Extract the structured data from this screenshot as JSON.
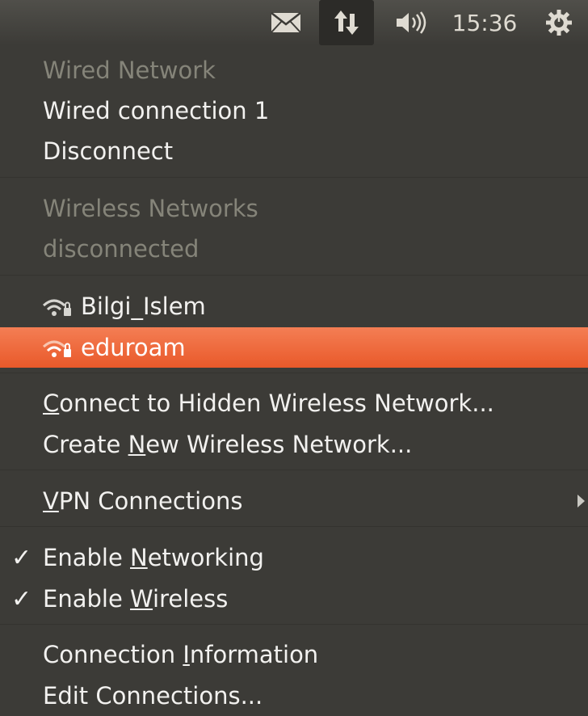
{
  "top_panel": {
    "clock": "15:36",
    "tray_icons": [
      "mail-icon",
      "network-arrows-icon",
      "volume-icon",
      "power-gear-icon"
    ]
  },
  "menu": {
    "wired": {
      "header": "Wired Network",
      "connection": "Wired connection 1",
      "disconnect": "Disconnect"
    },
    "wireless": {
      "header": "Wireless Networks",
      "status": "disconnected",
      "networks": [
        {
          "name": "Bilgi_Islem",
          "highlighted": false
        },
        {
          "name": "eduroam",
          "highlighted": true
        }
      ]
    },
    "hidden_network": {
      "prefix": "",
      "mnemonic": "C",
      "suffix": "onnect to Hidden Wireless Network..."
    },
    "new_network": {
      "prefix": "Create ",
      "mnemonic": "N",
      "suffix": "ew Wireless Network..."
    },
    "vpn": {
      "prefix": "",
      "mnemonic": "V",
      "suffix": "PN Connections"
    },
    "enable_networking": {
      "checked": true,
      "prefix": "Enable ",
      "mnemonic": "N",
      "suffix": "etworking"
    },
    "enable_wireless": {
      "checked": true,
      "prefix": "Enable ",
      "mnemonic": "W",
      "suffix": "ireless"
    },
    "connection_info": {
      "prefix": "Connection ",
      "mnemonic": "I",
      "suffix": "nformation"
    },
    "edit_connections": "Edit Connections...",
    "checkmark_glyph": "✓"
  },
  "colors": {
    "menu_bg": "#3c3b37",
    "text": "#f2f1ef",
    "disabled_text": "#858479",
    "highlight": "#e9592a"
  }
}
